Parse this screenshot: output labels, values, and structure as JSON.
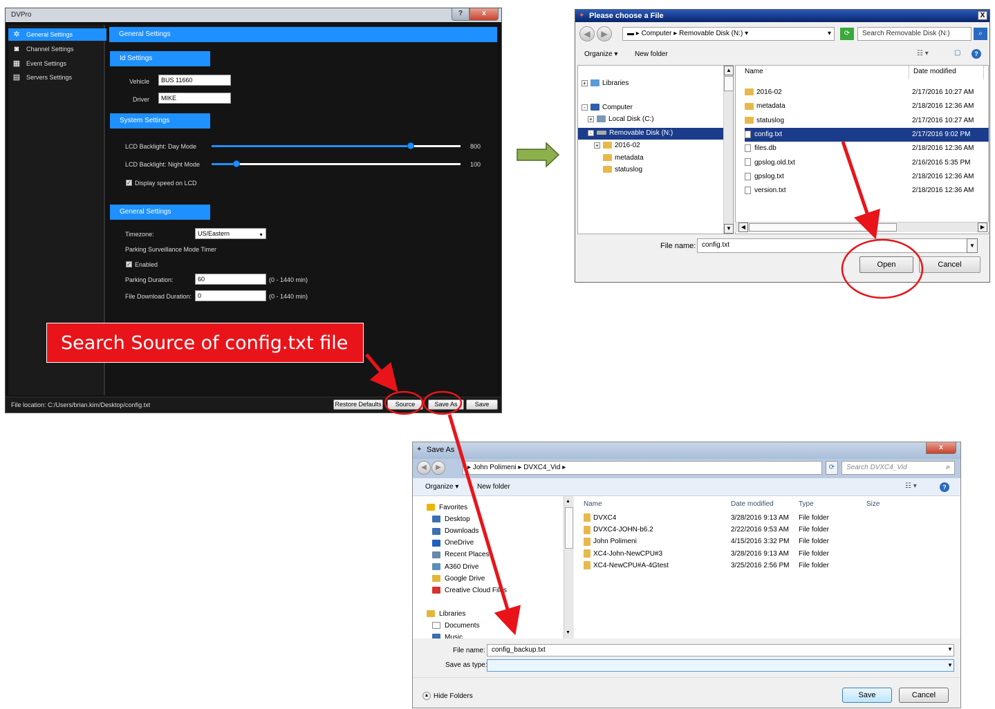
{
  "dvpro": {
    "title": "DVPro",
    "help": "?",
    "close": "x",
    "nav": [
      "General Settings",
      "Channel Settings",
      "Event Settings",
      "Servers Settings"
    ],
    "header": "General Settings",
    "id_section": "Id Settings",
    "vehicle_label": "Vehicle",
    "vehicle_value": "BUS 11660",
    "driver_label": "Driver",
    "driver_value": "MIKE",
    "system_section": "System Settings",
    "lcd_day_label": "LCD Backlight: Day Mode",
    "lcd_day_value": "800",
    "lcd_day_level": 0.8,
    "lcd_night_label": "LCD Backlight: Night Mode",
    "lcd_night_value": "100",
    "lcd_night_level": 0.1,
    "display_speed_label": "Display speed on LCD",
    "general_section": "General Settings",
    "timezone_label": "Timezone:",
    "timezone_value": "US/Eastern",
    "parking_timer_label": "Parking Surveillance Mode Timer",
    "enabled_label": "Enabled",
    "parking_duration_label": "Parking Duration:",
    "parking_duration_value": "60",
    "parking_duration_range": "(0 - 1440 min)",
    "file_download_label": "File Download Duration:",
    "file_download_value": "0",
    "file_download_range": "(0 - 1440 min)",
    "file_location": "File location: C:/Users/brian.kim/Desktop/config.txt",
    "buttons": [
      "Restore Defaults",
      "Source",
      "Save As",
      "Save"
    ]
  },
  "callout": "Search Source of config.txt file",
  "chooser": {
    "title": "Please choose a File",
    "close": "X",
    "breadcrumb": [
      "Computer",
      "Removable Disk (N:)"
    ],
    "search_placeholder": "Search Removable Disk (N:)",
    "organize": "Organize",
    "new_folder": "New folder",
    "tree": [
      {
        "label": "Libraries",
        "indent": 0,
        "exp": "+"
      },
      {
        "label": "Computer",
        "indent": 0,
        "exp": "-"
      },
      {
        "label": "Local Disk (C:)",
        "indent": 1,
        "exp": "+"
      },
      {
        "label": "Removable Disk (N:)",
        "indent": 1,
        "exp": "-"
      },
      {
        "label": "2016-02",
        "indent": 2,
        "exp": "+"
      },
      {
        "label": "metadata",
        "indent": 2,
        "exp": ""
      },
      {
        "label": "statuslog",
        "indent": 2,
        "exp": ""
      }
    ],
    "col_name": "Name",
    "col_date": "Date modified",
    "files": [
      {
        "name": "2016-02",
        "date": "2/17/2016 10:27 AM",
        "kind": "folder"
      },
      {
        "name": "metadata",
        "date": "2/18/2016 12:36 AM",
        "kind": "folder"
      },
      {
        "name": "statuslog",
        "date": "2/17/2016 10:27 AM",
        "kind": "folder"
      },
      {
        "name": "config.txt",
        "date": "2/17/2016 9:02 PM",
        "kind": "file"
      },
      {
        "name": "files.db",
        "date": "2/18/2016 12:36 AM",
        "kind": "file"
      },
      {
        "name": "gpslog.old.txt",
        "date": "2/16/2016 5:35 PM",
        "kind": "file"
      },
      {
        "name": "gpslog.txt",
        "date": "2/18/2016 12:36 AM",
        "kind": "file"
      },
      {
        "name": "version.txt",
        "date": "2/18/2016 12:36 AM",
        "kind": "file"
      }
    ],
    "file_name_label": "File name:",
    "file_name_value": "config.txt",
    "open": "Open",
    "cancel": "Cancel"
  },
  "saveas": {
    "title": "Save As",
    "breadcrumb": [
      "John Polimeni",
      "DVXC4_Vid"
    ],
    "search_placeholder": "Search DVXC4_Vid",
    "organize": "Organize",
    "new_folder": "New folder",
    "nav": [
      {
        "label": "Favorites",
        "head": true,
        "color": "#f0b400"
      },
      {
        "label": "Desktop",
        "head": false,
        "color": "#3a6fb0"
      },
      {
        "label": "Downloads",
        "head": false,
        "color": "#3a6fb0"
      },
      {
        "label": "OneDrive",
        "head": false,
        "color": "#1e5fc0"
      },
      {
        "label": "Recent Places",
        "head": false,
        "color": "#6a88a8"
      },
      {
        "label": "A360 Drive",
        "head": false,
        "color": "#5a8fb8"
      },
      {
        "label": "Google Drive",
        "head": false,
        "color": "#e3b63b"
      },
      {
        "label": "Creative Cloud Files",
        "head": false,
        "color": "#d6322f"
      },
      {
        "label": "",
        "head": false,
        "color": ""
      },
      {
        "label": "Libraries",
        "head": true,
        "color": "#e3b63b"
      },
      {
        "label": "Documents",
        "head": false,
        "color": "#ffffff"
      },
      {
        "label": "Music",
        "head": false,
        "color": "#3a6fb0"
      }
    ],
    "columns": [
      "Name",
      "Date modified",
      "Type",
      "Size"
    ],
    "rows": [
      {
        "name": "DVXC4",
        "date": "3/28/2016 9:13 AM",
        "type": "File folder"
      },
      {
        "name": "DVXC4-JOHN-b6.2",
        "date": "2/22/2016 9:53 AM",
        "type": "File folder"
      },
      {
        "name": "John Polimeni",
        "date": "4/15/2016 3:32 PM",
        "type": "File folder"
      },
      {
        "name": "XC4-John-NewCPU#3",
        "date": "3/28/2016 9:13 AM",
        "type": "File folder"
      },
      {
        "name": "XC4-NewCPU#A-4Gtest",
        "date": "3/25/2016 2:56 PM",
        "type": "File folder"
      }
    ],
    "file_name_label": "File name:",
    "file_name_value": "config_backup.txt",
    "save_type_label": "Save as type:",
    "hide_folders": "Hide Folders",
    "save": "Save",
    "cancel": "Cancel"
  },
  "colors": {
    "accent": "#1e90ff",
    "callout": "#e8141a",
    "arrow_green": "#8cb04c",
    "annotation": "#e8141a"
  }
}
